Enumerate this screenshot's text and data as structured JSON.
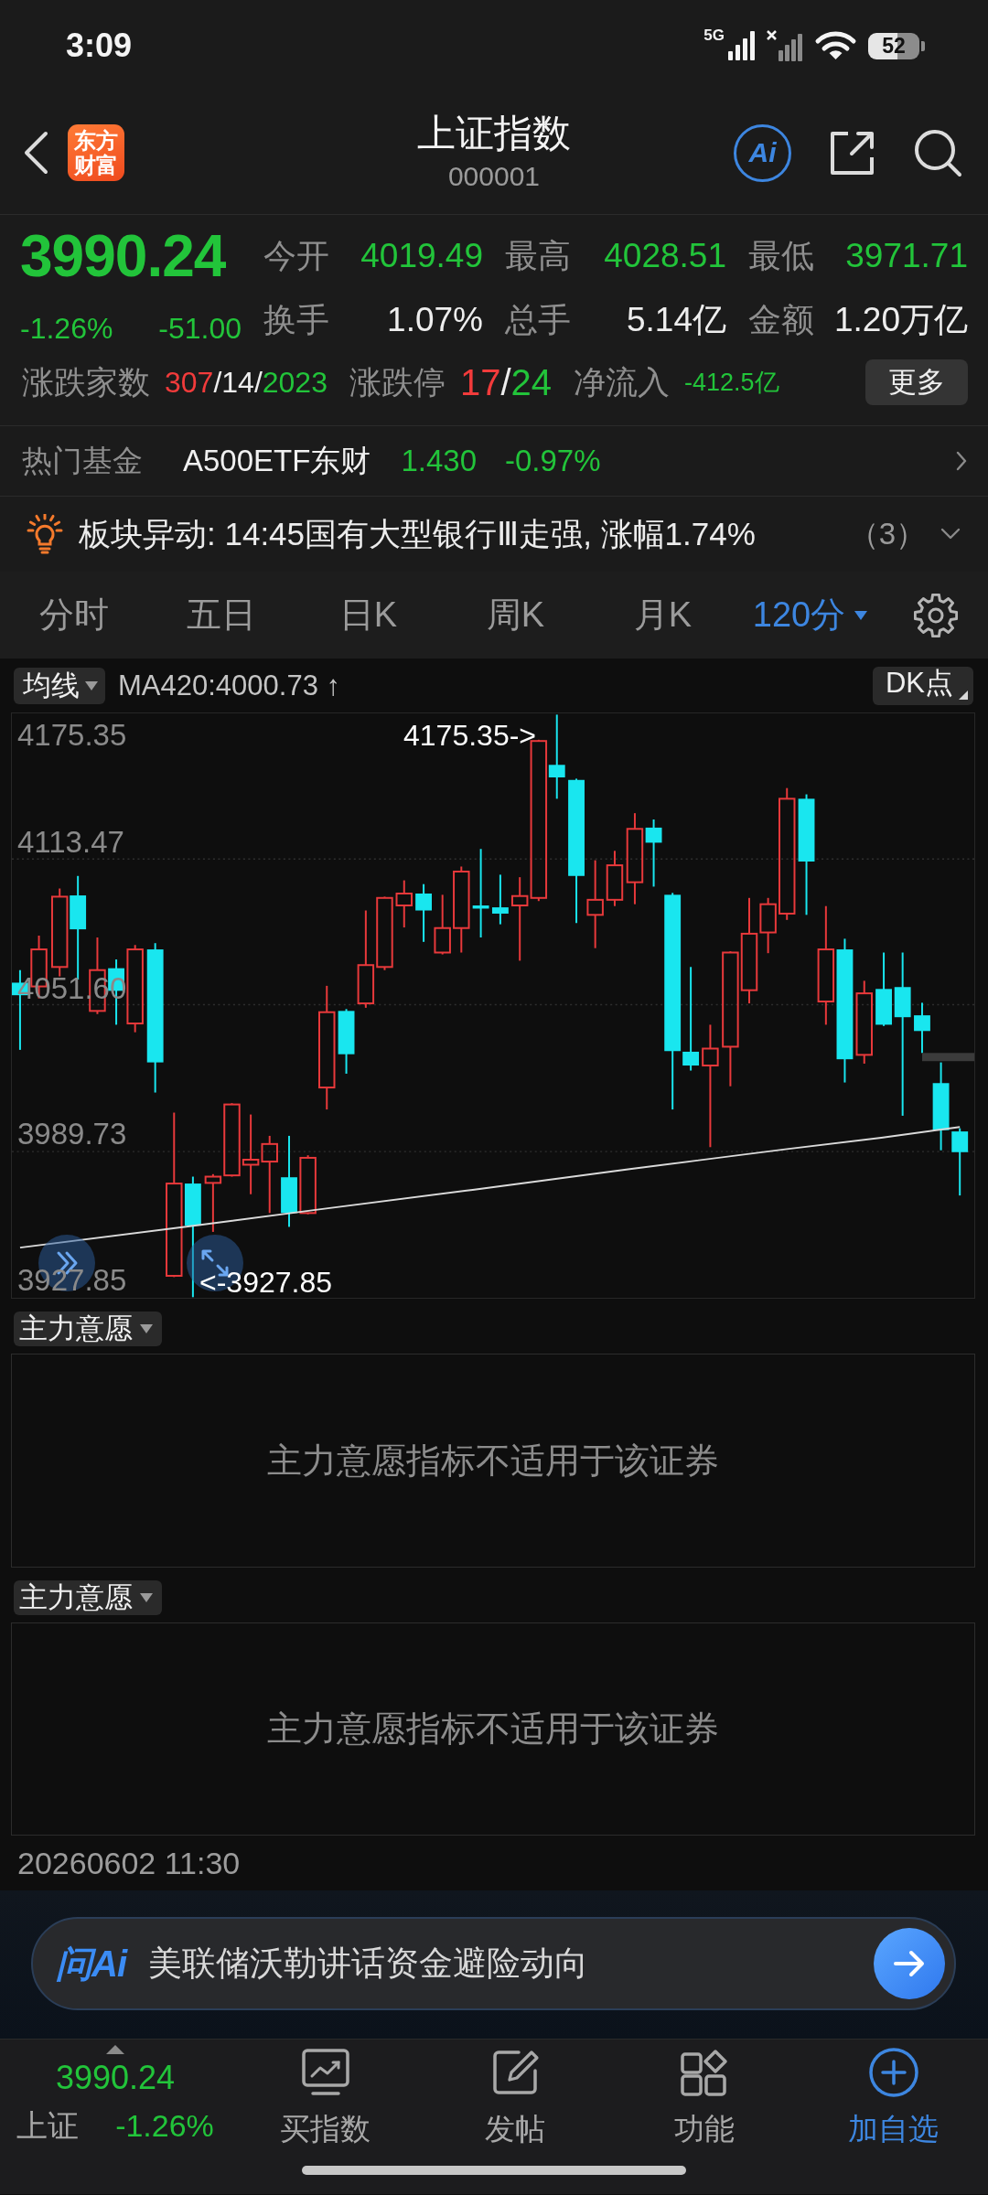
{
  "status_bar": {
    "time": "3:09",
    "network": "5G",
    "battery": "52"
  },
  "header": {
    "logo": "东方财富",
    "title": "上证指数",
    "code": "000001",
    "ai_label": "Ai"
  },
  "quote": {
    "price": "3990.24",
    "change_percent": "-1.26%",
    "change": "-51.00",
    "color": "#22c43a",
    "stats": [
      {
        "label": "今开",
        "value": "4019.49",
        "color": "#22c43a"
      },
      {
        "label": "最高",
        "value": "4028.51",
        "color": "#22c43a"
      },
      {
        "label": "最低",
        "value": "3971.71",
        "color": "#22c43a"
      },
      {
        "label": "换手",
        "value": "1.07%",
        "color": "#eeeeee"
      },
      {
        "label": "总手",
        "value": "5.14亿",
        "color": "#eeeeee"
      },
      {
        "label": "金额",
        "value": "1.20万亿",
        "color": "#eeeeee"
      }
    ],
    "breadth": [
      {
        "label": "涨跌家数",
        "kind": "counts",
        "parts": [
          {
            "text": "307",
            "color": "#f23b3b"
          },
          {
            "text": "/14/",
            "color": "#eeeeee"
          },
          {
            "text": "2023",
            "color": "#22c43a"
          }
        ]
      },
      {
        "label": "涨跌停",
        "kind": "limits",
        "parts": [
          {
            "text": "17",
            "color": "#f23b3b"
          },
          {
            "text": "/",
            "color": "#eeeeee"
          },
          {
            "text": "24",
            "color": "#22c43a"
          }
        ]
      },
      {
        "label": "净流入",
        "kind": "flow",
        "parts": [
          {
            "text": "-412.5亿",
            "color": "#22c43a"
          }
        ]
      }
    ],
    "more_button": "更多"
  },
  "hot_fund": {
    "label": "热门基金",
    "name": "A500ETF东财",
    "price": "1.430",
    "change": "-0.97%",
    "color": "#22c43a"
  },
  "alert": {
    "text": "板块异动: 14:45国有大型银行Ⅲ走强, 涨幅1.74%",
    "count": "（3）"
  },
  "tabs": [
    {
      "label": "分时",
      "kind": "plain",
      "selected": false
    },
    {
      "label": "五日",
      "kind": "plain",
      "selected": false
    },
    {
      "label": "日K",
      "kind": "plain",
      "selected": false
    },
    {
      "label": "周K",
      "kind": "plain",
      "selected": false
    },
    {
      "label": "月K",
      "kind": "plain",
      "selected": false
    },
    {
      "label": "120分",
      "kind": "dropdown",
      "selected": true
    }
  ],
  "chart": {
    "indicator": "均线",
    "ma_reading": "MA420:4000.73 ↑",
    "dk_label": "DK点",
    "y_labels": [
      "4175.35",
      "4113.47",
      "4051.60",
      "3989.73",
      "3927.85"
    ],
    "high_marker": "4175.35->",
    "low_marker": "<-3927.85"
  },
  "indicator_panels": [
    {
      "selector": "主力意愿",
      "message": "主力意愿指标不适用于该证券"
    },
    {
      "selector": "主力意愿",
      "message": "主力意愿指标不适用于该证券"
    }
  ],
  "timestamp": "20260602 11:30",
  "ask_bar": {
    "logo": "问Ai",
    "prompt": "美联储沃勒讲话资金避险动向"
  },
  "bottom_nav": {
    "quote": {
      "price": "3990.24",
      "name": "上证",
      "change": "-1.26%",
      "color": "#22c43a"
    },
    "actions": [
      {
        "label": "买指数",
        "kind": "plain"
      },
      {
        "label": "发帖",
        "kind": "plain"
      },
      {
        "label": "功能",
        "kind": "plain"
      },
      {
        "label": "加自选",
        "kind": "accent"
      }
    ]
  }
}
